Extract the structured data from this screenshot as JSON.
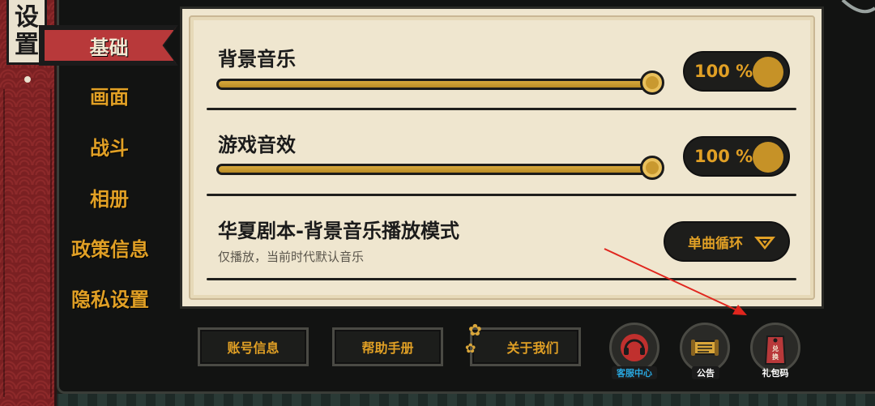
{
  "sidebar": {
    "title_chars": [
      "设",
      "置"
    ],
    "items": [
      {
        "label": "基础",
        "active": true
      },
      {
        "label": "画面",
        "active": false
      },
      {
        "label": "战斗",
        "active": false
      },
      {
        "label": "相册",
        "active": false
      },
      {
        "label": "政策信息",
        "active": false
      },
      {
        "label": "隐私设置",
        "active": false
      }
    ]
  },
  "settings": {
    "bgm": {
      "label": "背景音乐",
      "value_text": "100 %",
      "level": 1.0
    },
    "sfx": {
      "label": "游戏音效",
      "value_text": "100 %",
      "level": 1.0
    },
    "mode": {
      "label": "华夏剧本-背景音乐播放模式",
      "description": "仅播放，当前时代默认音乐",
      "selected": "单曲循环"
    }
  },
  "footer": {
    "account_label": "账号信息",
    "help_label": "帮助手册",
    "about_label": "关于我们",
    "support_label": "客服中心",
    "notice_label": "公告",
    "gift_label": "礼包码",
    "gift_badge_text": "兑换"
  },
  "colors": {
    "accent": "#e1a025",
    "red": "#b8393a",
    "card": "#efe6cf",
    "support_label_color": "#29a8e0"
  }
}
